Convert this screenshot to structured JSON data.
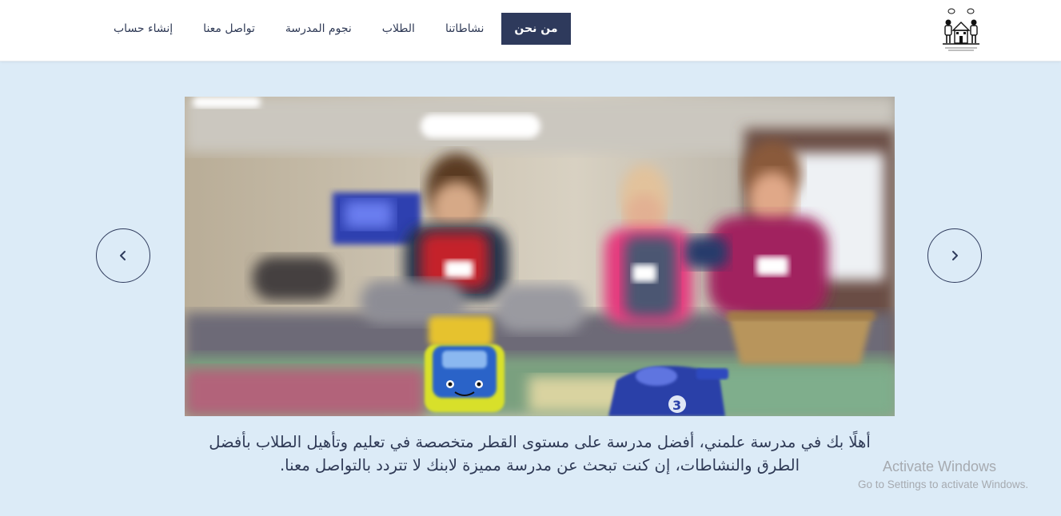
{
  "nav": {
    "items": [
      {
        "label": "من نحن",
        "active": true
      },
      {
        "label": "نشاطاتنا",
        "active": false
      },
      {
        "label": "الطلاب",
        "active": false
      },
      {
        "label": "نجوم المدرسة",
        "active": false
      },
      {
        "label": "تواصل معنا",
        "active": false
      },
      {
        "label": "إنشاء حساب",
        "active": false
      }
    ],
    "logo_icon": "school-children-logo-icon"
  },
  "slider": {
    "prev_icon": "chevron-left-icon",
    "next_icon": "chevron-right-icon",
    "slide_image": "blurred-children-playing-with-toy-cars-photo"
  },
  "welcome_text": "أهلًا بك في مدرسة علمني، أفضل مدرسة على مستوى القطر متخصصة في تعليم وتأهيل الطلاب بأفضل الطرق والنشاطات، إن كنت تبحث عن مدرسة مميزة لابنك لا تتردد بالتواصل معنا.",
  "watermark": {
    "title": "Activate Windows",
    "subtitle": "Go to Settings to activate Windows."
  },
  "colors": {
    "page_bg": "#dcebf7",
    "navy": "#2e3a5c",
    "text": "#2f3a56"
  }
}
